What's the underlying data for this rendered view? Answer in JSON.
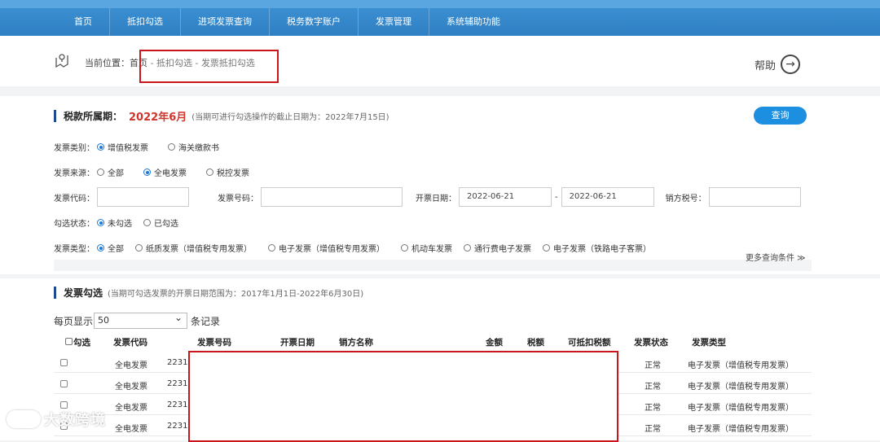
{
  "nav": [
    "首页",
    "抵扣勾选",
    "进项发票查询",
    "税务数字账户",
    "发票管理",
    "系统辅助功能"
  ],
  "breadcrumb": {
    "prefix": "当前位置：",
    "home": "首页",
    "sep": " - ",
    "level1": "抵扣勾选",
    "level2": "发票抵扣勾选"
  },
  "help": "帮助",
  "section1": {
    "title": "税款所属期：",
    "period": "2022年6月",
    "hint": "(当期可进行勾选操作的截止日期为：2022年7月15日)",
    "query_button": "查询"
  },
  "filters": {
    "invoice_category": {
      "label": "发票类别：",
      "options": [
        "增值税发票",
        "海关缴款书"
      ],
      "selected": 0
    },
    "invoice_source": {
      "label": "发票来源：",
      "options": [
        "全部",
        "全电发票",
        "税控发票"
      ],
      "selected": 1
    },
    "invoice_code_label": "发票代码：",
    "invoice_number_label": "发票号码：",
    "date_label": "开票日期：",
    "date_from": "2022-06-21",
    "date_sep": "-",
    "date_to": "2022-06-21",
    "seller_tax_label": "销方税号：",
    "select_status": {
      "label": "勾选状态：",
      "options": [
        "未勾选",
        "已勾选"
      ],
      "selected": 0
    },
    "invoice_type": {
      "label": "发票类型：",
      "options": [
        "全部",
        "纸质发票（增值税专用发票）",
        "电子发票（增值税专用发票）",
        "机动车发票",
        "通行费电子发票",
        "电子发票（铁路电子客票）"
      ],
      "selected": 0
    },
    "more": "更多查询条件 ≫"
  },
  "section2": {
    "title": "发票勾选",
    "hint": "(当期可勾选发票的开票日期范围为：2017年1月1日-2022年6月30日)"
  },
  "pagination": {
    "prefix": "每页显示",
    "value": "50",
    "suffix": "条记录"
  },
  "table": {
    "headers": [
      "勾选",
      "发票代码",
      "发票号码",
      "开票日期",
      "销方名称",
      "金额",
      "税额",
      "可抵扣税额",
      "发票状态",
      "发票类型"
    ],
    "rows": [
      {
        "code": "全电发票",
        "number": "2231",
        "status": "正常",
        "type": "电子发票（增值税专用发票）"
      },
      {
        "code": "全电发票",
        "number": "2231",
        "status": "正常",
        "type": "电子发票（增值税专用发票）"
      },
      {
        "code": "全电发票",
        "number": "2231",
        "status": "正常",
        "type": "电子发票（增值税专用发票）"
      },
      {
        "code": "全电发票",
        "number": "2231",
        "status": "正常",
        "type": "电子发票（增值税专用发票）"
      }
    ]
  },
  "watermark": "大数跨境"
}
